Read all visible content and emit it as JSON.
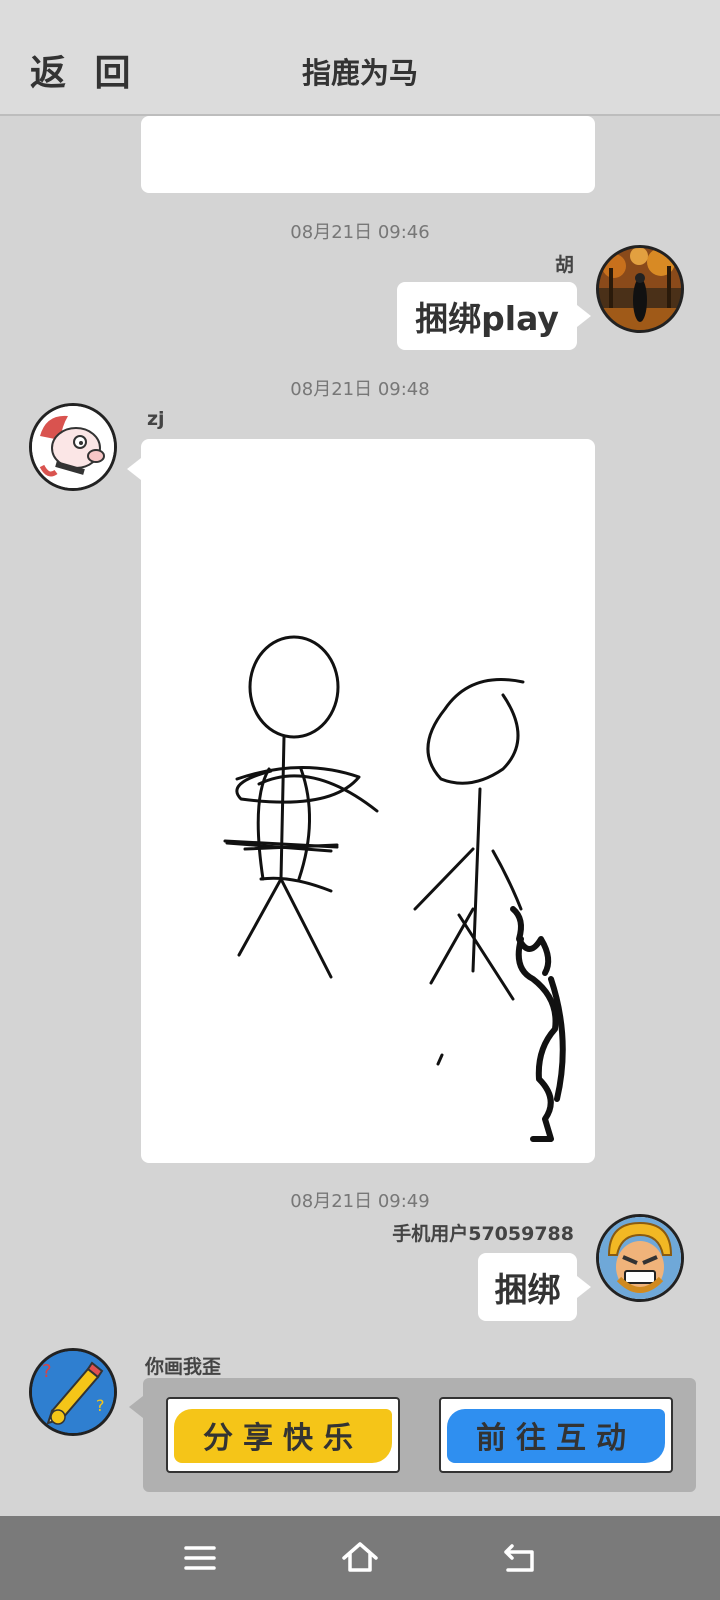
{
  "header": {
    "back_label": "返 回",
    "title": "指鹿为马"
  },
  "messages": [
    {
      "timestamp": "08月21日  09:46",
      "sender": "胡",
      "text": "捆绑play",
      "side": "right"
    },
    {
      "timestamp": "08月21日  09:48",
      "sender": "zj",
      "content": "drawing",
      "side": "left"
    },
    {
      "timestamp": "08月21日  09:49",
      "sender": "手机用户57059788",
      "text": "捆绑",
      "side": "right"
    }
  ],
  "game_card": {
    "sender": "你画我歪",
    "share_label": "分享快乐",
    "interact_label": "前往互动",
    "share_color": "#f5c518",
    "interact_color": "#2f8ff0"
  },
  "navbar": {
    "icons": [
      "menu-icon",
      "home-icon",
      "back-icon"
    ]
  }
}
